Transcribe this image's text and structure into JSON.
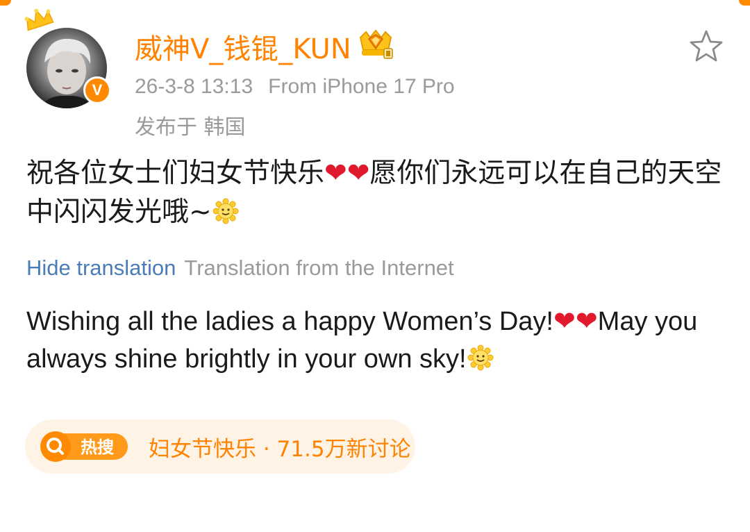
{
  "post": {
    "username": "威神V_钱锟_KUN",
    "timestamp": "26-3-8 13:13",
    "source": "From iPhone 17 Pro",
    "location": "发布于 韩国",
    "text_part1": "祝各位女士们妇女节快乐",
    "hearts": "❤❤",
    "text_part2": "愿你们永远可以在自己的天空中闪闪发光哦~",
    "verified_badge": "V"
  },
  "translation": {
    "hide_label": "Hide translation",
    "source_label": "Translation from the Internet",
    "text_part1": "Wishing all the ladies a happy Women’s Day!",
    "hearts": "❤❤",
    "text_part2": "May you always shine brightly in your own sky!"
  },
  "hot_search": {
    "badge_label": "热搜",
    "topic": "妇女节快乐 · 71.5万新讨论"
  },
  "icons": {
    "crown": "crown-icon",
    "vip": "vip-diamond-icon",
    "star": "star-outline-icon",
    "sun": "sun-smile-emoji",
    "search": "search-icon"
  },
  "colors": {
    "accent": "#ff8200",
    "link": "#4a7db8",
    "muted": "#9a9a9a",
    "text": "#1a1a1a",
    "heart": "#e0192c",
    "pill_bg": "#fff3e6"
  }
}
